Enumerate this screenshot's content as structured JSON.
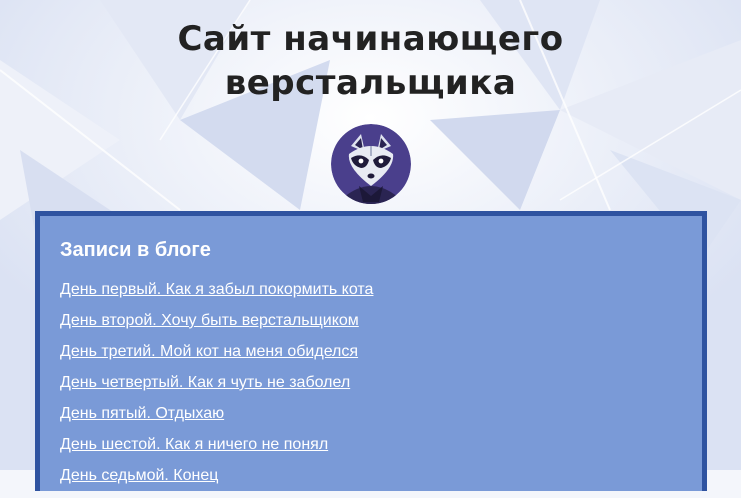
{
  "header": {
    "site_title_line1": "Сайт начинающего",
    "site_title_line2": "верстальщика",
    "avatar_icon": "raccoon-icon"
  },
  "blog": {
    "heading": "Записи в блоге",
    "posts": [
      {
        "label": "День первый. Как я забыл покормить кота"
      },
      {
        "label": "День второй. Хочу быть верстальщиком"
      },
      {
        "label": "День третий. Мой кот на меня обиделся"
      },
      {
        "label": "День четвертый. Как я чуть не заболел"
      },
      {
        "label": "День пятый. Отдыхаю"
      },
      {
        "label": "День шестой. Как я ничего не понял"
      },
      {
        "label": "День седьмой. Конец"
      }
    ]
  },
  "colors": {
    "panel_bg": "#7a9ad7",
    "panel_border": "#2f53a0",
    "title_text": "#222222",
    "avatar_bg": "#4a3f8c"
  }
}
